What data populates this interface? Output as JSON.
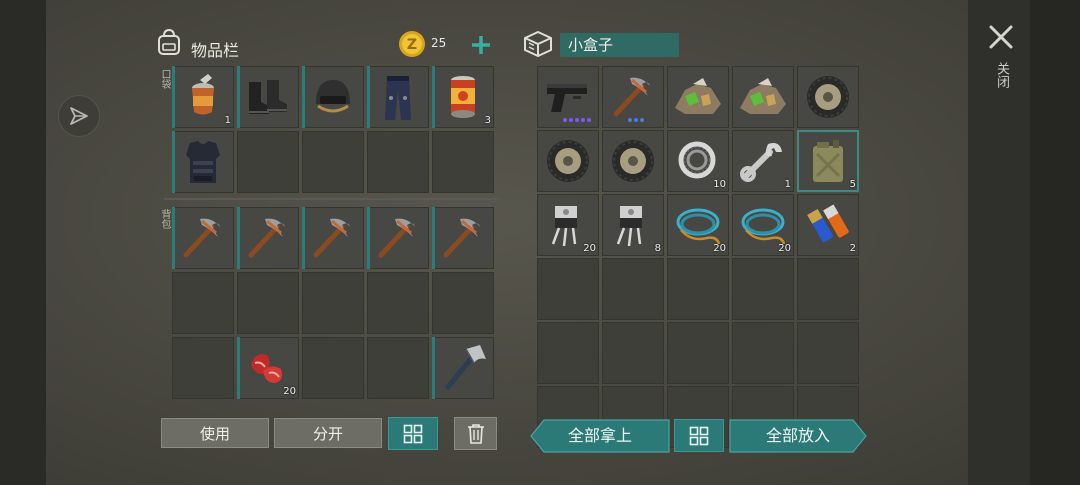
{
  "inventory": {
    "title": "物品栏",
    "coins": "25",
    "pocket_label": "口袋",
    "backpack_label": "背包",
    "pocket_slots": [
      {
        "icon": "food-can-icon",
        "count": "1"
      },
      {
        "icon": "boots-icon",
        "count": ""
      },
      {
        "icon": "helmet-icon",
        "count": ""
      },
      {
        "icon": "pants-icon",
        "count": ""
      },
      {
        "icon": "canned-food-icon",
        "count": "3"
      },
      {
        "icon": "armor-vest-icon",
        "count": ""
      },
      {
        "icon": "",
        "count": ""
      },
      {
        "icon": "",
        "count": ""
      },
      {
        "icon": "",
        "count": ""
      },
      {
        "icon": "",
        "count": ""
      }
    ],
    "backpack_slots": [
      {
        "icon": "pickaxe-icon",
        "count": ""
      },
      {
        "icon": "pickaxe-icon",
        "count": ""
      },
      {
        "icon": "pickaxe-icon",
        "count": ""
      },
      {
        "icon": "pickaxe-icon",
        "count": ""
      },
      {
        "icon": "pickaxe-icon",
        "count": ""
      },
      {
        "icon": "",
        "count": ""
      },
      {
        "icon": "",
        "count": ""
      },
      {
        "icon": "",
        "count": ""
      },
      {
        "icon": "",
        "count": ""
      },
      {
        "icon": "",
        "count": ""
      },
      {
        "icon": "",
        "count": ""
      },
      {
        "icon": "raw-meat-icon",
        "count": "20"
      },
      {
        "icon": "",
        "count": ""
      },
      {
        "icon": "",
        "count": ""
      },
      {
        "icon": "hatchet-icon",
        "count": ""
      }
    ],
    "use_label": "使用",
    "split_label": "分开"
  },
  "container": {
    "title": "小盒子",
    "slots": [
      {
        "icon": "pistol-icon",
        "count": ""
      },
      {
        "icon": "pickaxe-icon",
        "count": ""
      },
      {
        "icon": "ore-icon",
        "count": ""
      },
      {
        "icon": "ore-icon",
        "count": ""
      },
      {
        "icon": "tire-icon",
        "count": ""
      },
      {
        "icon": "tire-icon",
        "count": ""
      },
      {
        "icon": "tire-icon",
        "count": ""
      },
      {
        "icon": "bearing-icon",
        "count": "10"
      },
      {
        "icon": "wrench-icon",
        "count": "1"
      },
      {
        "icon": "jerrycan-icon",
        "count": "5"
      },
      {
        "icon": "transistor-icon",
        "count": "20"
      },
      {
        "icon": "transistor-icon",
        "count": "8"
      },
      {
        "icon": "wire-icon",
        "count": "20"
      },
      {
        "icon": "wire-icon",
        "count": "20"
      },
      {
        "icon": "battery-icon",
        "count": "2"
      },
      {
        "icon": "",
        "count": ""
      },
      {
        "icon": "",
        "count": ""
      },
      {
        "icon": "",
        "count": ""
      },
      {
        "icon": "",
        "count": ""
      },
      {
        "icon": "",
        "count": ""
      },
      {
        "icon": "",
        "count": ""
      },
      {
        "icon": "",
        "count": ""
      },
      {
        "icon": "",
        "count": ""
      },
      {
        "icon": "",
        "count": ""
      },
      {
        "icon": "",
        "count": ""
      },
      {
        "icon": "",
        "count": ""
      },
      {
        "icon": "",
        "count": ""
      },
      {
        "icon": "",
        "count": ""
      },
      {
        "icon": "",
        "count": ""
      },
      {
        "icon": "",
        "count": ""
      }
    ],
    "take_all_label": "全部拿上",
    "put_all_label": "全部放入"
  },
  "close_label": "关闭",
  "colors": {
    "accent": "#2b7a77",
    "slot_bar": "#2b7d7c",
    "coin": "#e0b020"
  }
}
